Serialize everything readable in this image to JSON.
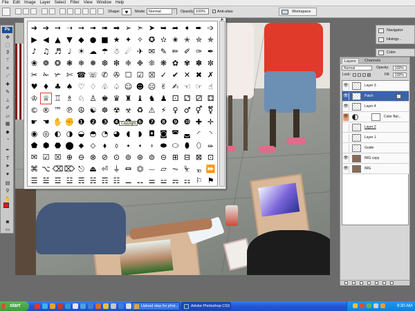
{
  "menu": [
    "File",
    "Edit",
    "Image",
    "Layer",
    "Select",
    "Filter",
    "View",
    "Window",
    "Help"
  ],
  "options_bar": {
    "shape_label": "Shape:",
    "mode_label": "Mode:",
    "mode_value": "Normal",
    "opacity_label": "Opacity:",
    "opacity_value": "100%",
    "antialias_label": "Anti-alias",
    "workspace_label": "Workspace"
  },
  "tools": {
    "logo": "Ps",
    "icons": [
      "move-icon",
      "marquee-icon",
      "lasso-icon",
      "magic-wand-icon",
      "crop-icon",
      "slice-icon",
      "healing-icon",
      "brush-icon",
      "clone-stamp-icon",
      "history-brush-icon",
      "eraser-icon",
      "gradient-icon",
      "blur-icon",
      "dodge-icon",
      "pen-icon",
      "type-icon",
      "path-select-icon",
      "shape-icon",
      "notes-icon",
      "eyedropper-icon",
      "hand-icon",
      "zoom-icon"
    ],
    "foreground_color": "#e0190f",
    "background_color": "#ffffff"
  },
  "shape_picker": {
    "tooltip": "Copyright",
    "selected_index": 97,
    "rows": [
      [
        "➜",
        "➔",
        "➙",
        "➝",
        "➞",
        "➟",
        "➠",
        "➡",
        "➢",
        "➣",
        "➤",
        "➥",
        "➦",
        "➧",
        "➨",
        "➩"
      ],
      [
        "▶",
        "◀",
        "▲",
        "▼",
        "◆",
        "●",
        "■",
        "★",
        "✦",
        "✧",
        "✪",
        "✫",
        "✬",
        "✭",
        "✮",
        "✯"
      ],
      [
        "♪",
        "♫",
        "♬",
        "♩",
        "☀",
        "☁",
        "☂",
        "☃",
        "☄",
        "✈",
        "✉",
        "✎",
        "✏",
        "✐",
        "✑",
        "✒"
      ],
      [
        "❀",
        "❁",
        "❂",
        "❃",
        "❄",
        "❅",
        "❆",
        "❇",
        "❈",
        "❉",
        "❊",
        "❋",
        "✿",
        "✾",
        "✽",
        "✼"
      ],
      [
        "✂",
        "✁",
        "✃",
        "✄",
        "☎",
        "☏",
        "✆",
        "✇",
        "☐",
        "☑",
        "☒",
        "✓",
        "✔",
        "✕",
        "✖",
        "✗"
      ],
      [
        "♥",
        "♦",
        "♣",
        "♠",
        "♡",
        "♢",
        "♧",
        "♤",
        "☺",
        "☻",
        "☹",
        "✌",
        "✍",
        "☜",
        "☞",
        "☝"
      ],
      [
        "♔",
        "♕",
        "♖",
        "♗",
        "♘",
        "♙",
        "♚",
        "♛",
        "♜",
        "♝",
        "♞",
        "♟",
        "⚀",
        "⚁",
        "⚂",
        "⚃"
      ],
      [
        "©",
        "®",
        "™",
        "℗",
        "☮",
        "☯",
        "☸",
        "☢",
        "☣",
        "♻",
        "⚠",
        "⚡",
        "♀",
        "♂",
        "⚥",
        "⚧"
      ],
      [
        "☛",
        "☚",
        "✋",
        "✊",
        "❶",
        "❷",
        "❸",
        "❹",
        "❺",
        "❻",
        "❼",
        "❽",
        "❾",
        "❿",
        "✚",
        "✛"
      ],
      [
        "◉",
        "◎",
        "◐",
        "◑",
        "◒",
        "◓",
        "◔",
        "◕",
        "◖",
        "◗",
        "◘",
        "◙",
        "◚",
        "◛",
        "◜",
        "◝"
      ],
      [
        "⬟",
        "⬢",
        "⬣",
        "⬤",
        "⬥",
        "⬦",
        "⬧",
        "⬨",
        "⬩",
        "⬪",
        "⬫",
        "⬬",
        "⬭",
        "⬮",
        "⬯",
        "⬰"
      ],
      [
        "✉",
        "☑",
        "☒",
        "⊕",
        "⊖",
        "⊗",
        "⊘",
        "⊙",
        "⊚",
        "⊛",
        "⊜",
        "⊝",
        "⊞",
        "⊟",
        "⊠",
        "⊡"
      ],
      [
        "⌘",
        "⌥",
        "⌫",
        "⌦",
        "⎋",
        "⏏",
        "⏎",
        "⏚",
        "⏛",
        "⏣",
        "⏤",
        "⏥",
        "⏦",
        "⏧",
        "⏨",
        "⏩"
      ],
      [
        "☰",
        "☱",
        "☲",
        "☳",
        "☴",
        "☵",
        "☶",
        "☷",
        "⚊",
        "⚋",
        "⚌",
        "⚍",
        "⚎",
        "⚏",
        "⚐",
        "⚑"
      ]
    ]
  },
  "mini_panels": [
    {
      "label": "Navigator",
      "icon": "navigator-icon"
    },
    {
      "label": "Histogr...",
      "icon": "histogram-icon"
    },
    {
      "label": "Color",
      "icon": "color-icon"
    }
  ],
  "layers_panel": {
    "tabs": [
      "Layers",
      "Channels"
    ],
    "blend_mode": "Normal",
    "opacity_label": "Opacity:",
    "opacity_value": "100%",
    "lock_label": "Lock:",
    "fill_label": "Fill:",
    "fill_value": "100%",
    "layers": [
      {
        "name": "Layer 3",
        "selected": false
      },
      {
        "name": "Patch",
        "selected": true
      },
      {
        "name": "Layer 4",
        "selected": false
      },
      {
        "name": "Color Bal...",
        "selected": false
      },
      {
        "name": "Layer 2",
        "selected": false
      },
      {
        "name": "Layer 1",
        "selected": false
      },
      {
        "name": "Guide",
        "selected": false
      },
      {
        "name": "IMG copy",
        "selected": false
      },
      {
        "name": "IMG",
        "selected": false
      }
    ]
  },
  "taskbar": {
    "start_label": "start",
    "tasks": [
      {
        "label": "Upload step for phot...",
        "active": false
      },
      {
        "label": "Adobe Photoshop CS3",
        "active": true
      }
    ],
    "clock": "9:30 AM"
  }
}
